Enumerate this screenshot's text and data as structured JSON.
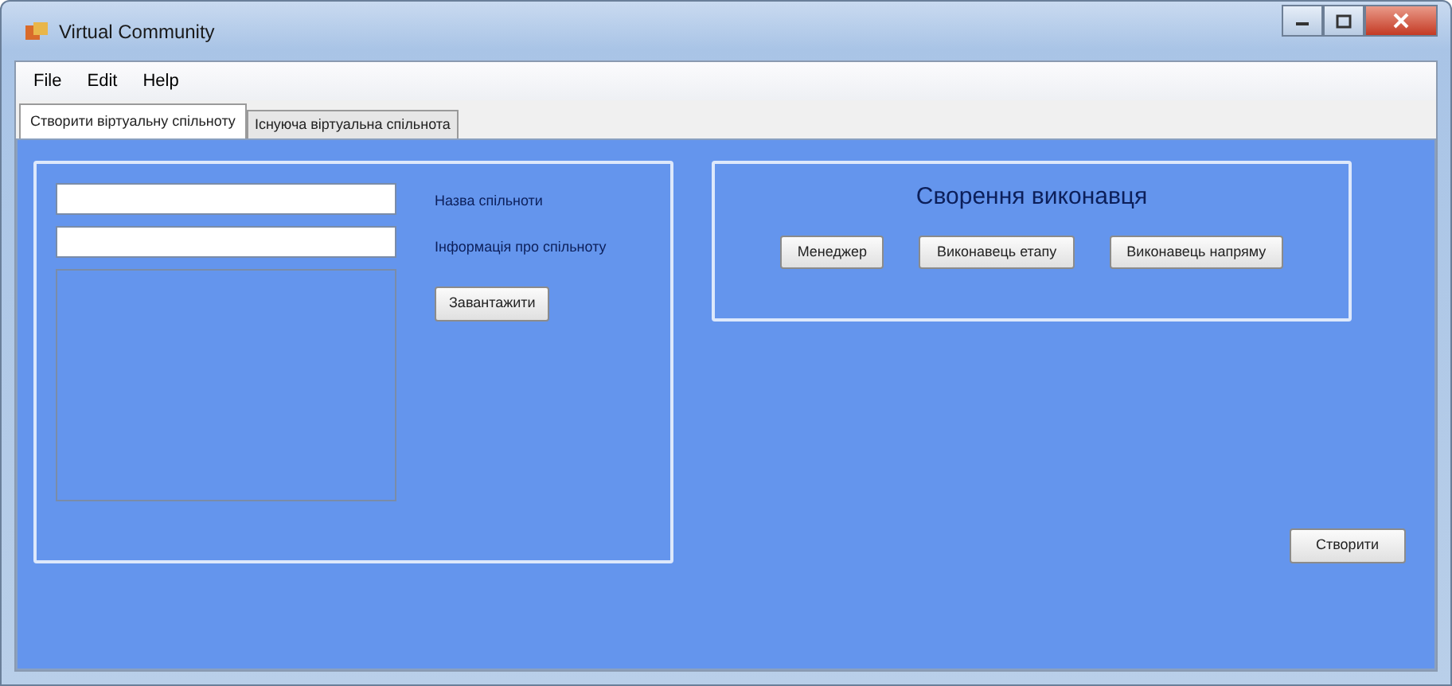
{
  "window": {
    "title": "Virtual Community"
  },
  "menu": [
    "File",
    "Edit",
    "Help"
  ],
  "tabs": [
    {
      "label": "Створити віртуальну спільноту",
      "selected": true
    },
    {
      "label": "Існуюча віртуальна спільнота",
      "selected": false
    }
  ],
  "community_group": {
    "name_field_label": "Назва спільноти",
    "info_field_label": "Інформація про спільноту",
    "load_button": "Завантажити"
  },
  "performer_group": {
    "title": "Сворення виконавця",
    "buttons": [
      "Менеджер",
      "Виконавець етапу",
      "Виконавець напряму"
    ]
  },
  "create_button": "Створити"
}
